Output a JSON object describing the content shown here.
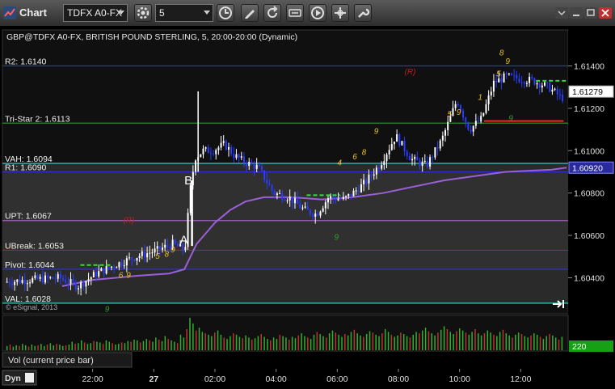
{
  "toolbar": {
    "title": "Chart",
    "symbol": "TDFX A0-FX",
    "interval": "5"
  },
  "chart_data": {
    "type": "candlestick",
    "title": "GBP@TDFX A0-FX, BRITISH POUND STERLING, 5, 20:00-20:00 (Dynamic)",
    "copyright": "© eSignal, 2013",
    "y_ticks": [
      1.604,
      1.606,
      1.608,
      1.61,
      1.612,
      1.614
    ],
    "y_tick_labels": [
      "1.60400",
      "1.60600",
      "1.60800",
      "1.61000",
      "1.61200",
      "1.61400"
    ],
    "ylim": [
      1.6023,
      1.6157
    ],
    "x_ticks": [
      "22:00",
      "27",
      "02:00",
      "04:00",
      "06:00",
      "08:00",
      "10:00",
      "12:00"
    ],
    "x_tick_hours": [
      22,
      24,
      26,
      28,
      30,
      32,
      34,
      36
    ],
    "xlim_hours": [
      19.05,
      37.55
    ],
    "last_price_label": "1.61279",
    "last_price": 1.61279,
    "vwap_label": "1.60920",
    "vwap_price": 1.6092,
    "levels": [
      {
        "name": "R2",
        "label": "R2: 1.6140",
        "value": 1.614,
        "color": "#3030c8"
      },
      {
        "name": "Tri-Star 2",
        "label": "Tri-Star 2: 1.6113",
        "value": 1.6113,
        "color": "#2f8a2f"
      },
      {
        "name": "VAH",
        "label": "VAH: 1.6094",
        "value": 1.6094,
        "color": "#3cc8c8"
      },
      {
        "name": "R1",
        "label": "R1: 1.6090",
        "value": 1.609,
        "color": "#3030c8"
      },
      {
        "name": "UPT",
        "label": "UPT: 1.6067",
        "value": 1.6067,
        "color": "#a060c0"
      },
      {
        "name": "UBreak",
        "label": "UBreak: 1.6053",
        "value": 1.6053,
        "color": "#b02020"
      },
      {
        "name": "Pivot",
        "label": "Pivot: 1.6044",
        "value": 1.6044,
        "color": "#3030c8"
      },
      {
        "name": "VAL",
        "label": "VAL: 1.6028",
        "value": 1.6028,
        "color": "#3cc8c8"
      }
    ],
    "price_path": [
      [
        19.2,
        1.6038
      ],
      [
        20.0,
        1.6039
      ],
      [
        21.0,
        1.604
      ],
      [
        21.6,
        1.6036
      ],
      [
        22.2,
        1.6042
      ],
      [
        22.8,
        1.6046
      ],
      [
        23.5,
        1.605
      ],
      [
        24.2,
        1.6053
      ],
      [
        24.7,
        1.6056
      ],
      [
        25.1,
        1.6053
      ],
      [
        25.3,
        1.6085
      ],
      [
        25.45,
        1.6097
      ],
      [
        25.7,
        1.61
      ],
      [
        26.0,
        1.61
      ],
      [
        26.4,
        1.6103
      ],
      [
        26.7,
        1.6098
      ],
      [
        27.0,
        1.6095
      ],
      [
        27.5,
        1.6092
      ],
      [
        28.0,
        1.608
      ],
      [
        28.5,
        1.6078
      ],
      [
        29.0,
        1.6072
      ],
      [
        29.4,
        1.607
      ],
      [
        29.8,
        1.6078
      ],
      [
        30.3,
        1.6077
      ],
      [
        30.6,
        1.608
      ],
      [
        31.0,
        1.6085
      ],
      [
        31.5,
        1.6094
      ],
      [
        32.0,
        1.6107
      ],
      [
        32.5,
        1.6096
      ],
      [
        33.0,
        1.6093
      ],
      [
        33.5,
        1.6105
      ],
      [
        34.0,
        1.6124
      ],
      [
        34.4,
        1.611
      ],
      [
        34.8,
        1.6115
      ],
      [
        35.2,
        1.6132
      ],
      [
        35.6,
        1.6135
      ],
      [
        36.0,
        1.6134
      ],
      [
        36.5,
        1.6133
      ],
      [
        37.0,
        1.613
      ],
      [
        37.4,
        1.6125
      ]
    ],
    "vwap_path": [
      [
        21.0,
        1.6036
      ],
      [
        22.0,
        1.6039
      ],
      [
        23.5,
        1.6041
      ],
      [
        24.5,
        1.6042
      ],
      [
        25.0,
        1.6044
      ],
      [
        25.4,
        1.6056
      ],
      [
        26.0,
        1.6066
      ],
      [
        26.5,
        1.6072
      ],
      [
        27.0,
        1.6076
      ],
      [
        27.6,
        1.6078
      ],
      [
        28.5,
        1.6078
      ],
      [
        29.5,
        1.6077
      ],
      [
        30.5,
        1.6078
      ],
      [
        31.5,
        1.608
      ],
      [
        32.5,
        1.6083
      ],
      [
        33.5,
        1.6086
      ],
      [
        34.5,
        1.6088
      ],
      [
        35.5,
        1.609
      ],
      [
        37.0,
        1.6091
      ],
      [
        37.5,
        1.6092
      ]
    ],
    "annotations": [
      {
        "text": "A",
        "x": 24.85,
        "y": 1.6056,
        "color": "#ffffff"
      },
      {
        "text": "B",
        "x": 25.0,
        "y": 1.6084,
        "color": "#ffffff"
      },
      {
        "text": "(R)",
        "x": 23.0,
        "y": 1.6066,
        "color": "#c02020"
      },
      {
        "text": "(R)",
        "x": 32.2,
        "y": 1.6136,
        "color": "#c02020"
      },
      {
        "text": "9",
        "x": 31.2,
        "y": 1.6108,
        "color": "#e8c020"
      },
      {
        "text": "8",
        "x": 35.3,
        "y": 1.6145,
        "color": "#e8c020"
      },
      {
        "text": "9",
        "x": 35.5,
        "y": 1.6141,
        "color": "#e8c020"
      },
      {
        "text": "5",
        "x": 35.2,
        "y": 1.6135,
        "color": "#e8c020"
      },
      {
        "text": "1",
        "x": 34.6,
        "y": 1.6124,
        "color": "#e8c020"
      },
      {
        "text": "5",
        "x": 33.6,
        "y": 1.6116,
        "color": "#e8c020"
      },
      {
        "text": "9",
        "x": 33.9,
        "y": 1.6117,
        "color": "#e8c020"
      },
      {
        "text": "8",
        "x": 30.8,
        "y": 1.6098,
        "color": "#e8c020"
      },
      {
        "text": "6",
        "x": 30.5,
        "y": 1.6096,
        "color": "#e8c020"
      },
      {
        "text": "4",
        "x": 30.0,
        "y": 1.6093,
        "color": "#e8c020"
      },
      {
        "text": "9",
        "x": 23.1,
        "y": 1.604,
        "color": "#e8c020"
      },
      {
        "text": "6",
        "x": 22.85,
        "y": 1.604,
        "color": "#e8c020"
      },
      {
        "text": "8",
        "x": 24.35,
        "y": 1.605,
        "color": "#e8c020"
      },
      {
        "text": "9",
        "x": 24.55,
        "y": 1.6052,
        "color": "#e8c020"
      },
      {
        "text": "5",
        "x": 24.05,
        "y": 1.6049,
        "color": "#e8c020"
      },
      {
        "text": "9",
        "x": 22.4,
        "y": 1.6024,
        "color": "#2fa02f"
      },
      {
        "text": "9",
        "x": 29.9,
        "y": 1.6058,
        "color": "#2fa02f"
      },
      {
        "text": "9",
        "x": 35.6,
        "y": 1.6114,
        "color": "#2fa02f"
      }
    ],
    "volume_label": "Vol (current price bar)",
    "volume_value": "220",
    "volume": [
      6,
      8,
      5,
      7,
      6,
      9,
      7,
      5,
      8,
      6,
      7,
      9,
      6,
      8,
      10,
      7,
      9,
      8,
      6,
      7,
      8,
      12,
      9,
      10,
      14,
      11,
      9,
      10,
      13,
      12,
      11,
      9,
      14,
      12,
      10,
      8,
      9,
      11,
      10,
      13,
      12,
      15,
      14,
      11,
      13,
      16,
      14,
      12,
      18,
      15,
      13,
      20,
      16,
      14,
      12,
      10,
      22,
      18,
      30,
      46,
      38,
      28,
      32,
      26,
      24,
      22,
      20,
      25,
      28,
      22,
      18,
      16,
      20,
      24,
      22,
      19,
      17,
      21,
      18,
      15,
      17,
      20,
      23,
      19,
      16,
      14,
      18,
      16,
      22,
      20,
      18,
      15,
      19,
      17,
      21,
      24,
      20,
      18,
      16,
      22,
      26,
      23,
      20,
      18,
      24,
      28,
      25,
      22,
      19,
      23,
      21,
      26,
      29,
      24,
      21,
      19,
      23,
      27,
      25,
      22,
      20,
      24,
      30,
      26,
      22,
      19,
      21,
      25,
      23,
      20,
      18,
      22,
      26,
      24,
      28,
      32,
      27,
      24,
      21,
      25,
      29,
      34,
      30,
      26,
      23,
      27,
      31,
      28,
      25,
      22,
      26,
      30,
      24,
      21,
      24,
      28,
      25,
      22,
      20,
      26,
      29,
      24,
      21,
      18,
      22,
      25,
      23,
      20,
      18,
      21,
      24,
      22,
      19,
      16,
      20,
      23,
      21,
      18,
      15,
      19
    ]
  }
}
